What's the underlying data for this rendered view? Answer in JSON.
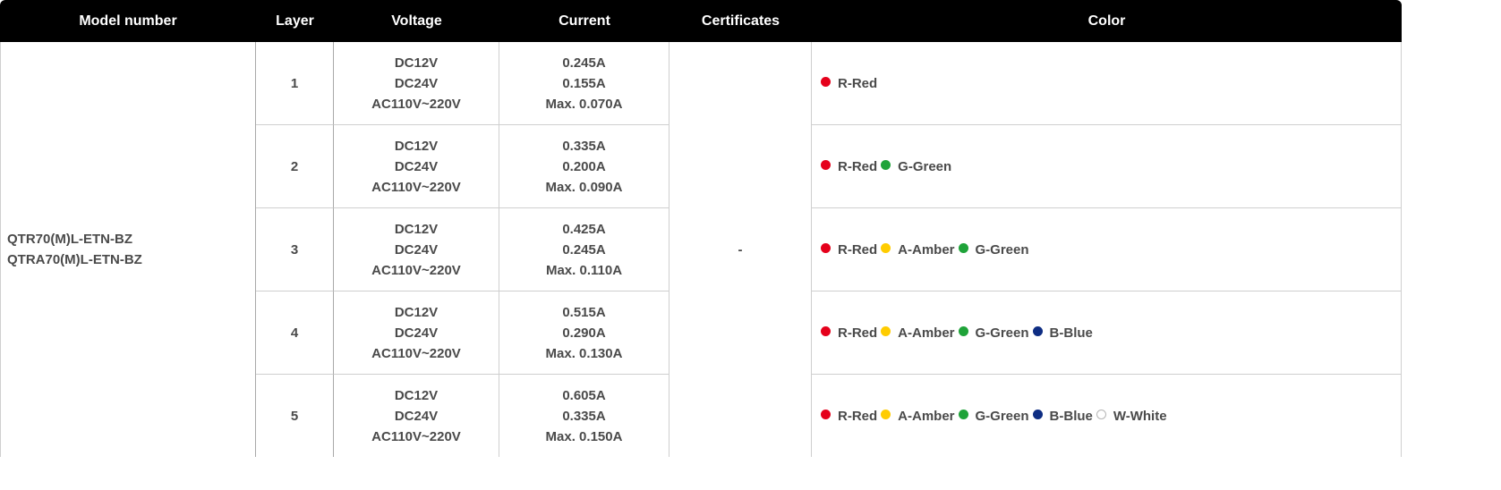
{
  "headers": [
    "Model number",
    "Layer",
    "Voltage",
    "Current",
    "Certificates",
    "Color"
  ],
  "model": {
    "lines": [
      "QTR70(M)L-ETN-BZ",
      "QTRA70(M)L-ETN-BZ"
    ]
  },
  "certificates": "-",
  "colors": {
    "red": {
      "label": "R-Red",
      "hex": "#e5001b"
    },
    "amber": {
      "label": "A-Amber",
      "hex": "#ffcc00"
    },
    "green": {
      "label": "G-Green",
      "hex": "#1fa339"
    },
    "blue": {
      "label": "B-Blue",
      "hex": "#0e2d83"
    },
    "white": {
      "label": "W-White",
      "hex": "#ffffff"
    }
  },
  "rows": [
    {
      "layer": "1",
      "voltage": [
        "DC12V",
        "DC24V",
        "AC110V~220V"
      ],
      "current": [
        "0.245A",
        "0.155A",
        "Max. 0.070A"
      ],
      "colors": [
        "R-Red"
      ]
    },
    {
      "layer": "2",
      "voltage": [
        "DC12V",
        "DC24V",
        "AC110V~220V"
      ],
      "current": [
        "0.335A",
        "0.200A",
        "Max. 0.090A"
      ],
      "colors": [
        "R-Red",
        "G-Green"
      ]
    },
    {
      "layer": "3",
      "voltage": [
        "DC12V",
        "DC24V",
        "AC110V~220V"
      ],
      "current": [
        "0.425A",
        "0.245A",
        "Max. 0.110A"
      ],
      "colors": [
        "R-Red",
        "A-Amber",
        "G-Green"
      ]
    },
    {
      "layer": "4",
      "voltage": [
        "DC12V",
        "DC24V",
        "AC110V~220V"
      ],
      "current": [
        "0.515A",
        "0.290A",
        "Max. 0.130A"
      ],
      "colors": [
        "R-Red",
        "A-Amber",
        "G-Green",
        "B-Blue"
      ]
    },
    {
      "layer": "5",
      "voltage": [
        "DC12V",
        "DC24V",
        "AC110V~220V"
      ],
      "current": [
        "0.605A",
        "0.335A",
        "Max. 0.150A"
      ],
      "colors": [
        "R-Red",
        "A-Amber",
        "G-Green",
        "B-Blue",
        "W-White"
      ]
    }
  ]
}
